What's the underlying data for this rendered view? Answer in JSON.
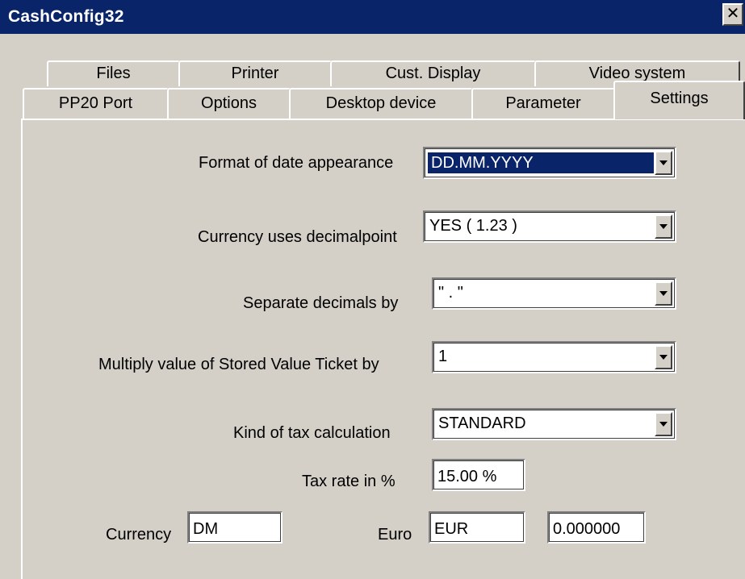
{
  "window": {
    "title": "CashConfig32",
    "close_glyph": "✕"
  },
  "tabs": {
    "back_row": [
      "Files",
      "Printer",
      "Cust. Display",
      "Video system"
    ],
    "front_row": [
      "PP20 Port",
      "Options",
      "Desktop device",
      "Parameter"
    ],
    "active": "Settings"
  },
  "settings": {
    "date_format": {
      "label": "Format of date appearance",
      "value": "DD.MM.YYYY"
    },
    "currency_decimalpoint": {
      "label": "Currency uses decimalpoint",
      "value": "YES ( 1.23 )"
    },
    "separate_decimals": {
      "label": "Separate decimals by",
      "value": "\" . \""
    },
    "multiply_ticket": {
      "label": "Multiply value of Stored Value Ticket by",
      "value": "1"
    },
    "tax_kind": {
      "label": "Kind of tax calculation",
      "value": "STANDARD"
    },
    "tax_rate": {
      "label": "Tax rate in %",
      "value": "15.00 %"
    },
    "currency": {
      "label": "Currency",
      "value": "DM"
    },
    "euro": {
      "label": "Euro",
      "value": "EUR",
      "rate": "0.000000"
    }
  },
  "icons": {
    "dropdown": "chevron-down-icon"
  },
  "colors": {
    "titlebar": "#0a246a",
    "face": "#d4d0c8",
    "selection": "#0a246a"
  }
}
